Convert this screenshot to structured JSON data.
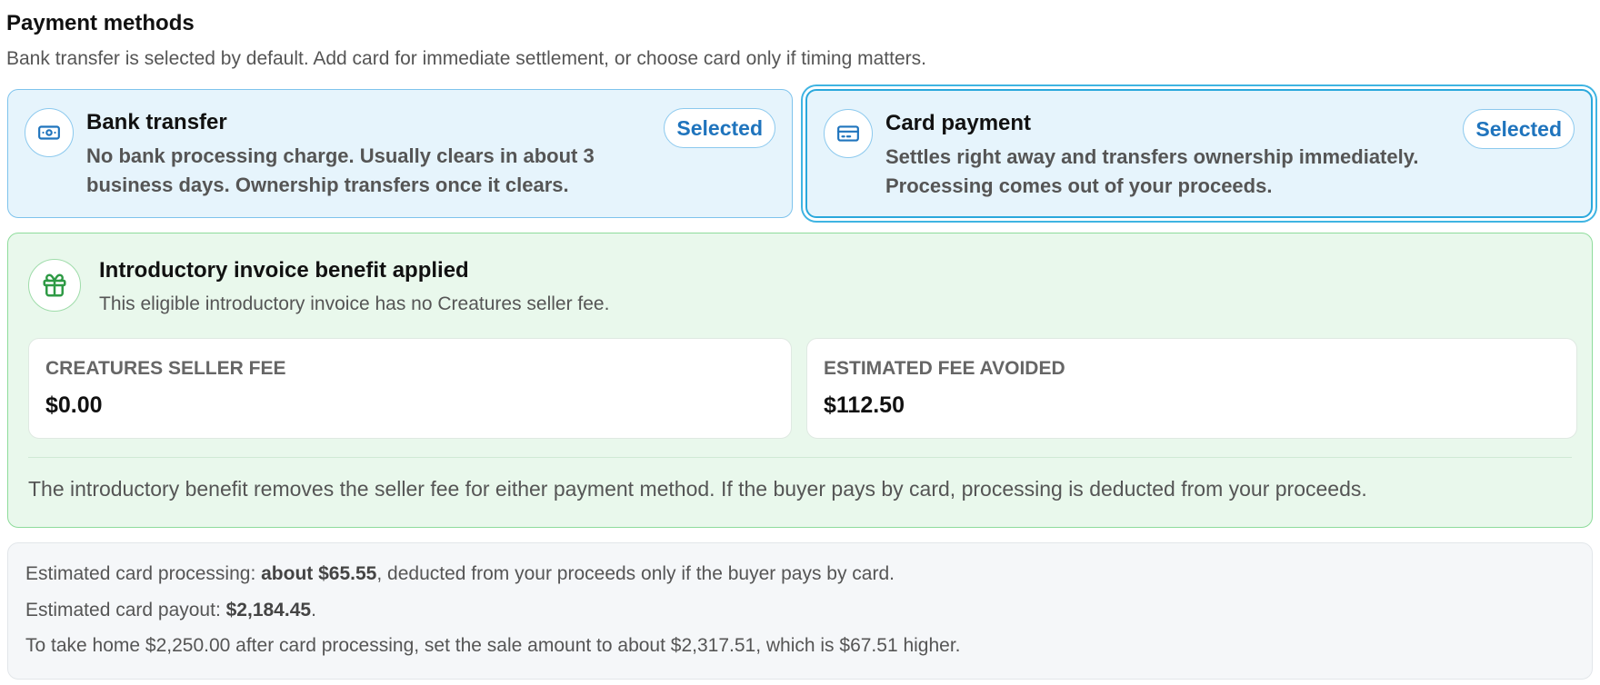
{
  "header": {
    "title": "Payment methods",
    "description": "Bank transfer is selected by default. Add card for immediate settlement, or choose card only if timing matters."
  },
  "methods": [
    {
      "icon": "banknote-icon",
      "title": "Bank transfer",
      "description": "No bank processing charge. Usually clears in about 3 business days. Ownership transfers once it clears.",
      "badge": "Selected"
    },
    {
      "icon": "credit-card-icon",
      "title": "Card payment",
      "description": "Settles right away and transfers ownership immediately. Processing comes out of your proceeds.",
      "badge": "Selected"
    }
  ],
  "benefit": {
    "icon": "gift-icon",
    "title": "Introductory invoice benefit applied",
    "description": "This eligible introductory invoice has no Creatures seller fee.",
    "stats": [
      {
        "label": "CREATURES SELLER FEE",
        "value": "$0.00"
      },
      {
        "label": "ESTIMATED FEE AVOIDED",
        "value": "$112.50"
      }
    ],
    "note": "The introductory benefit removes the seller fee for either payment method. If the buyer pays by card, processing is deducted from your proceeds."
  },
  "summary": {
    "processing_prefix": "Estimated card processing: ",
    "processing_amount": "about $65.55",
    "processing_suffix": ", deducted from your proceeds only if the buyer pays by card.",
    "payout_prefix": "Estimated card payout: ",
    "payout_amount": "$2,184.45",
    "payout_suffix": ".",
    "take_home": "To take home $2,250.00 after card processing, set the sale amount to about $2,317.51, which is $67.51 higher."
  },
  "colors": {
    "accent_blue": "#1f74bd",
    "card_bg": "#e6f4fc",
    "benefit_bg": "#e9f8ec",
    "benefit_icon": "#2e9a45"
  }
}
